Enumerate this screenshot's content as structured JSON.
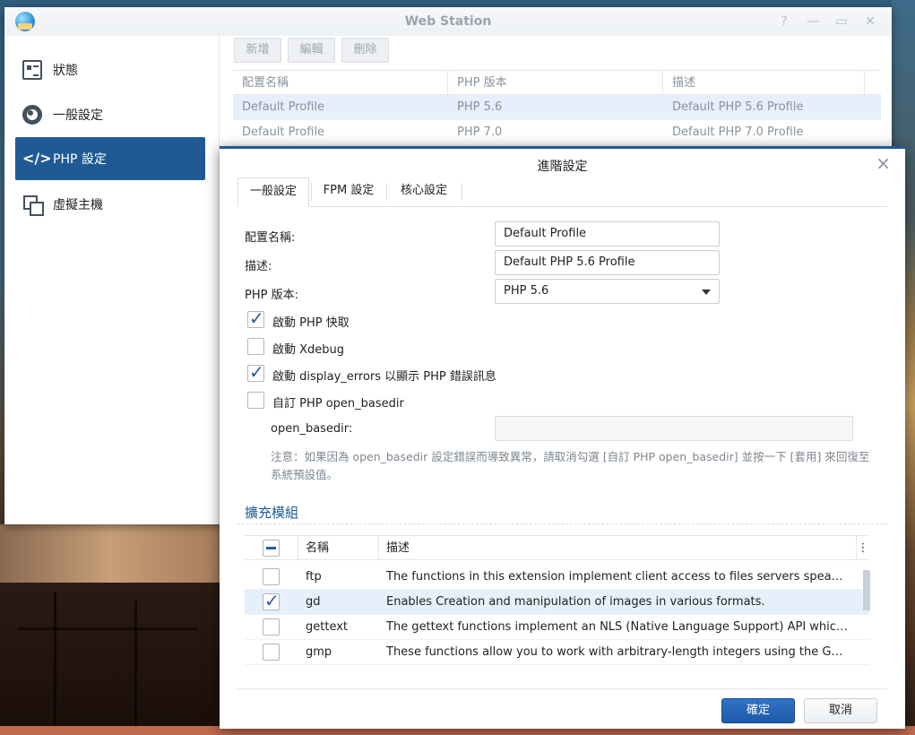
{
  "window": {
    "title": "Web Station",
    "controls": {
      "help": "?",
      "minimize": "—",
      "maximize": "▭",
      "close": "✕"
    }
  },
  "sidebar": {
    "items": [
      {
        "label": "狀態",
        "icon": "status-icon"
      },
      {
        "label": "一般設定",
        "icon": "gear-icon"
      },
      {
        "label": "PHP 設定",
        "icon": "code-icon",
        "active": true
      },
      {
        "label": "虛擬主機",
        "icon": "virtual-host-icon"
      }
    ]
  },
  "toolbar": {
    "add": "新增",
    "edit": "編輯",
    "delete": "刪除"
  },
  "profiles": {
    "columns": [
      "配置名稱",
      "PHP 版本",
      "描述"
    ],
    "rows": [
      [
        "Default Profile",
        "PHP 5.6",
        "Default PHP 5.6 Profile"
      ],
      [
        "Default Profile",
        "PHP 7.0",
        "Default PHP 7.0 Profile"
      ]
    ]
  },
  "dialog": {
    "title": "進階設定",
    "close_icon": "×",
    "tabs": [
      "一般設定",
      "FPM 設定",
      "核心設定"
    ],
    "form": {
      "profile_name_label": "配置名稱:",
      "profile_name_value": "Default Profile",
      "description_label": "描述:",
      "description_value": "Default PHP 5.6 Profile",
      "php_version_label": "PHP 版本:",
      "php_version_value": "PHP 5.6"
    },
    "options": [
      {
        "label": "啟動 PHP 快取",
        "checked": true
      },
      {
        "label": "啟動 Xdebug",
        "checked": false
      },
      {
        "label": "啟動 display_errors 以顯示 PHP 錯誤訊息",
        "checked": true
      },
      {
        "label": "自訂 PHP open_basedir",
        "checked": false
      }
    ],
    "open_basedir_label": "open_basedir:",
    "note": "注意：如果因為 open_basedir 設定錯誤而導致異常，請取消勾選 [自訂 PHP open_basedir] 並按一下 [套用] 來回復至系統預設值。",
    "extensions": {
      "section_title": "擴充模組",
      "columns": {
        "name": "名稱",
        "description": "描述",
        "menu": "⋮"
      },
      "rows": [
        {
          "name": "ftp",
          "checked": false,
          "description": "The functions in this extension implement client access to files servers speaking th…"
        },
        {
          "name": "gd",
          "checked": true,
          "description": "Enables Creation and manipulation of images in various formats."
        },
        {
          "name": "gettext",
          "checked": false,
          "description": "The gettext functions implement an NLS (Native Language Support) API which can…"
        },
        {
          "name": "gmp",
          "checked": false,
          "description": "These functions allow you to work with arbitrary-length integers using the GNU MP…"
        }
      ]
    },
    "buttons": {
      "ok": "確定",
      "cancel": "取消"
    }
  },
  "colors": {
    "accent": "#1f5a95",
    "selection": "#e6f0fa",
    "check": "#2a5aa0"
  }
}
